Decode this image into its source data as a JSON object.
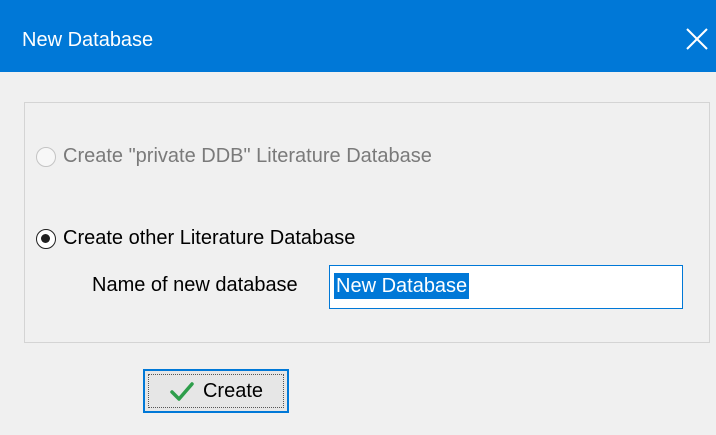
{
  "window": {
    "title": "New Database",
    "close_glyph": "✕",
    "close_icon": "close-icon",
    "accent_color": "#0078d7"
  },
  "options": [
    {
      "label": "Create \"private DDB\" Literature Database",
      "selected": false,
      "enabled": false
    },
    {
      "label": "Create other Literature Database",
      "selected": true,
      "enabled": true
    }
  ],
  "name_field": {
    "label": "Name of new database",
    "value": "New Database"
  },
  "create_button": {
    "label": "Create",
    "icon": "checkmark-icon",
    "icon_color": "#2e9e4b"
  }
}
